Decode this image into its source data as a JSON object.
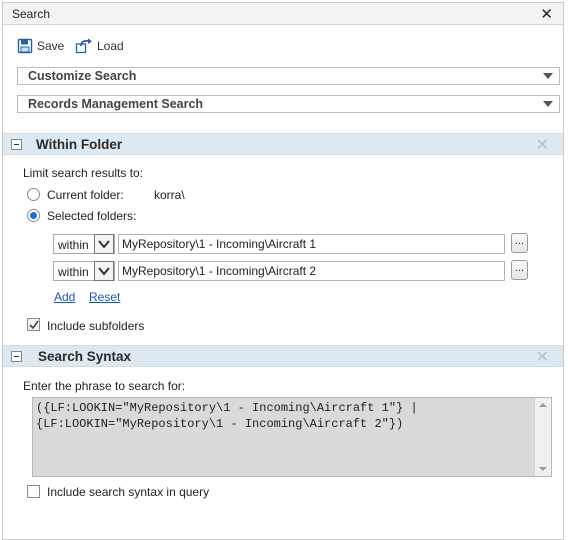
{
  "window": {
    "title": "Search",
    "close_glyph": "✕"
  },
  "toolbar": {
    "save_label": "Save",
    "load_label": "Load"
  },
  "dropdowns": [
    {
      "label": "Customize Search"
    },
    {
      "label": "Records Management Search"
    }
  ],
  "within_folder": {
    "title": "Within Folder",
    "close_glyph": "✕",
    "limit_label": "Limit search results to:",
    "current_folder_label": "Current folder:",
    "current_folder_value": "korra\\",
    "selected_folders_label": "Selected folders:",
    "selected_option": "selected_folders",
    "rows": [
      {
        "scope": "within",
        "path": "MyRepository\\1 - Incoming\\Aircraft 1",
        "browse_label": "..."
      },
      {
        "scope": "within",
        "path": "MyRepository\\1 - Incoming\\Aircraft 2",
        "browse_label": "..."
      }
    ],
    "add_label": "Add",
    "reset_label": "Reset",
    "include_subfolders_label": "Include subfolders",
    "include_subfolders_checked": true
  },
  "search_syntax": {
    "title": "Search Syntax",
    "close_glyph": "✕",
    "prompt": "Enter the phrase to search for:",
    "query_line1": "({LF:LOOKIN=\"MyRepository\\1 - Incoming\\Aircraft 1\"} |",
    "query_line2": "{LF:LOOKIN=\"MyRepository\\1 - Incoming\\Aircraft 2\"})",
    "include_syntax_label": "Include search syntax in query",
    "include_syntax_checked": false
  },
  "colors": {
    "section_header_bg": "#dde8f0",
    "link": "#1a57b5",
    "radio_fill": "#1e6fd6"
  },
  "icons": {
    "save": "save-disk-icon",
    "load": "load-arrow-icon"
  }
}
